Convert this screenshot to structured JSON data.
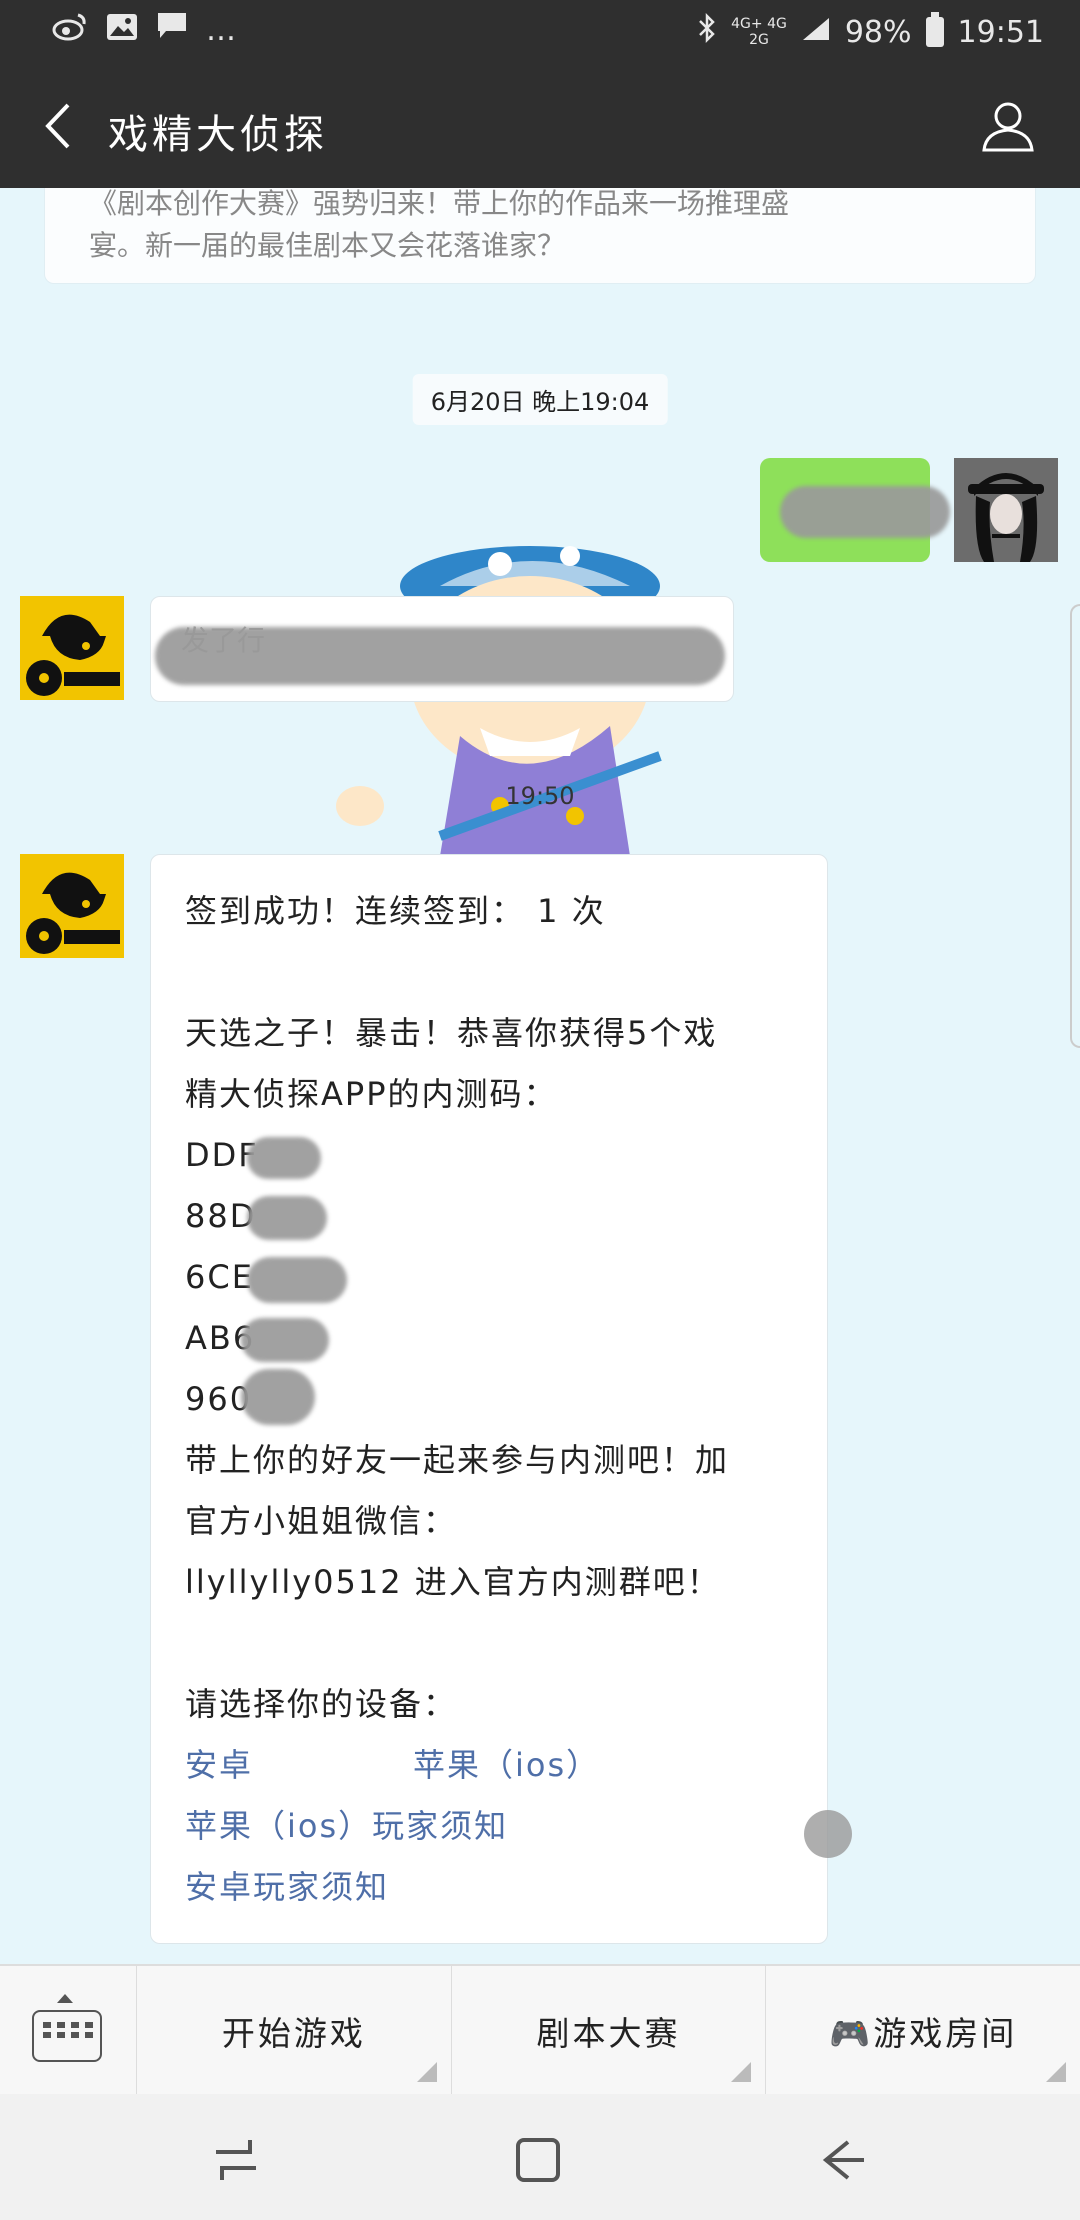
{
  "status_bar": {
    "network_top": "4G+ 4G",
    "network_bottom": "2G",
    "battery": "98%",
    "time": "19:51",
    "icons": [
      "weibo-icon",
      "image-icon",
      "message-icon",
      "more-icon"
    ]
  },
  "header": {
    "title": "戏精大侦探"
  },
  "chat": {
    "card_lines": [
      "《剧本创作大赛》强势归来！带上你的作品来一场推理盛",
      "宴。新一届的最佳剧本又会花落谁家？"
    ],
    "timestamp_1": "6月20日 晚上19:04",
    "timestamp_2": "19:50",
    "bot_message_1_visible": "发了行",
    "message": {
      "line1": "签到成功！连续签到： 1 次",
      "line2": "天选之子！暴击！恭喜你获得5个戏",
      "line3": "精大侦探APP的内测码：",
      "codes": [
        "DDF",
        "88D",
        "6CE",
        "AB6",
        "960"
      ],
      "line4": "带上你的好友一起来参与内测吧！加",
      "line5": "官方小姐姐微信：",
      "line6": "llyllylly0512 进入官方内测群吧！",
      "line7": "请选择你的设备：",
      "link_android": "安卓",
      "link_ios": "苹果（ios）",
      "link_ios_notice": "苹果（ios）玩家须知",
      "link_android_notice": "安卓玩家须知"
    }
  },
  "menu": {
    "btn1": "开始游戏",
    "btn2": "剧本大赛",
    "btn3": "🎮游戏房间"
  },
  "colors": {
    "chat_bg": "#e6f6fb",
    "header_bg": "#2f2f2f",
    "green_bubble": "#8ee05a",
    "link": "#4f6fa8"
  }
}
